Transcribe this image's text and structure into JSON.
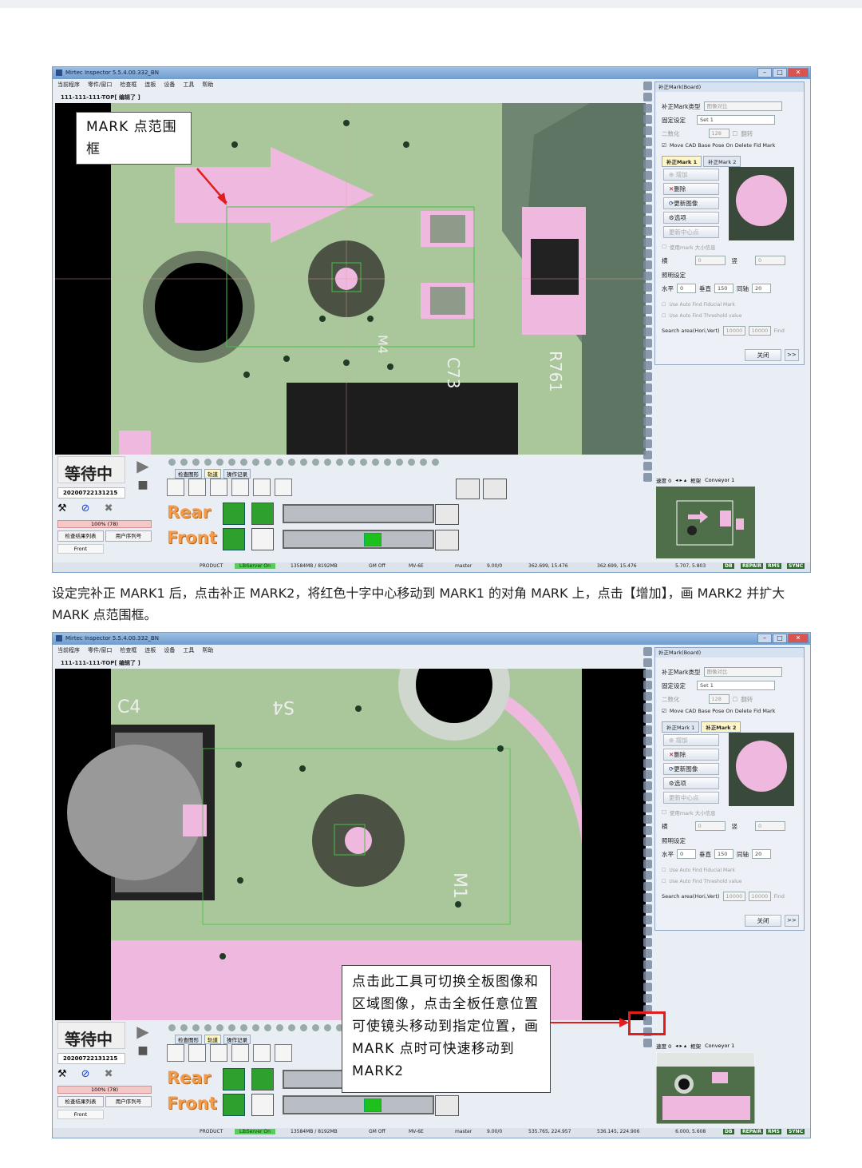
{
  "window": {
    "title": "Mirtec Inspector 5.5.4.00.332_BN",
    "menu": [
      "当前程序",
      "零件/窗口",
      "检查框",
      "连板",
      "设备",
      "工具",
      "帮助"
    ],
    "doc_path": "111-111-111-TOP[ 编辑了 ]"
  },
  "panel": {
    "title": "补正Mark(Board)",
    "type_label": "补正Mark类型",
    "type_value": "图像对比",
    "fixed_label": "固定设定",
    "fixed_value": "Set 1",
    "binarize_label": "二数化",
    "binarize_value": "128",
    "invert_label": "翻转",
    "move_cad": "Move CAD Base Pose On Delete Fid Mark",
    "tab1": "补正Mark 1",
    "tab2": "补正Mark 2",
    "btn_add": "增加",
    "btn_delete": "删除",
    "btn_update": "更新图像",
    "btn_option": "选项",
    "btn_center": "更新中心点",
    "use_mark_size": "使用mark 大小信息",
    "h_label": "横",
    "h_value": "0",
    "v_label": "竖",
    "v_value": "0",
    "light_label": "照明设定",
    "hz_label": "水平",
    "hz_value": "0",
    "vert_label": "垂直",
    "vert_value": "150",
    "same_label": "同轴",
    "same_value": "20",
    "auto_find": "Use Auto Find Fiducial Mark",
    "auto_thresh": "Use Auto Find Threshold value",
    "search_label": "Search area(Hori,Vert)",
    "search_h": "10000",
    "search_v": "10000",
    "find_btn": "Find",
    "close_btn": "关闭",
    "more_btn": ">>"
  },
  "bottom": {
    "status": "等待中",
    "date": "20200722131215",
    "progress": "100% (78)",
    "btn_result": "检查结果列表",
    "btn_user": "用户序列号",
    "front_small": "Front",
    "tab_a": "检查图形",
    "tab_b": "轨道",
    "tab_c": "操作记录",
    "rear": "Rear",
    "front": "Front"
  },
  "nav": {
    "speed": "速度 0",
    "frame": "框架",
    "conveyor": "Conveyor 1"
  },
  "status_line": {
    "product": "PRODUCT",
    "libserver": "LibServer On",
    "memory": "13584MB / 8192MB",
    "gm": "GM Off",
    "mv": "MV-6E",
    "master": "master",
    "version": "9.00/0",
    "tags": [
      "DB",
      "REPAIR",
      "RMS",
      "SYNC"
    ]
  },
  "shot1_status": {
    "coord_a": "362.699, 15.476",
    "coord_b": "362.699, 15.476",
    "coord_c": "5.707, 5.803"
  },
  "shot2_status": {
    "coord_a": "535.765, 224.957",
    "coord_b": "536.145, 224.906",
    "coord_c": "6.000, 5.608"
  },
  "board_labels": {
    "shot1_c": "C73",
    "shot1_r": "R761",
    "shot1_m": "M4",
    "shot2_s": "S4",
    "shot2_m": "M1",
    "shot2_c": "C4"
  },
  "annotations": {
    "callout1": "MARK 点范围框",
    "caption": "设定完补正 MARK1 后，点击补正 MARK2，将红色十字中心移动到 MARK1 的对角 MARK 上，点击【增加】，画 MARK2 并扩大 MARK 点范围框。",
    "callout2": "点击此工具可切换全板图像和区域图像，点击全板任意位置可使镜头移动到指定位置，画 MARK 点时可快速移动到 MARK2"
  },
  "colors": {
    "pcb_green": "#a9c79a",
    "pad_pink": "#efb8df",
    "highlight_red": "#e21d1d"
  }
}
